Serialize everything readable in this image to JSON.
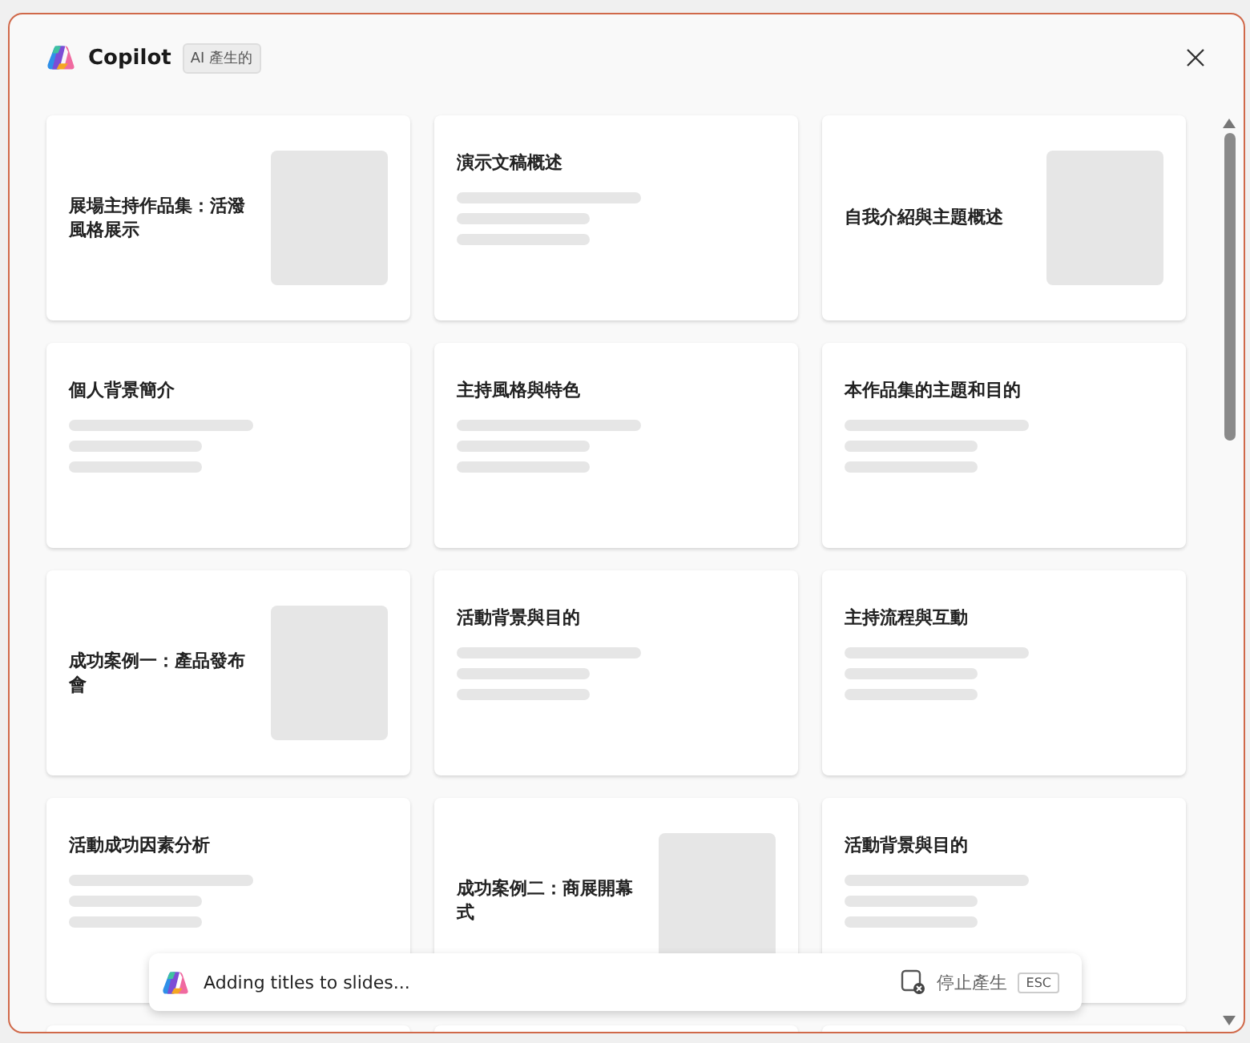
{
  "header": {
    "title": "Copilot",
    "badge": "AI 產生的"
  },
  "cards": [
    {
      "kind": "image",
      "title": "展場主持作品集：活潑風格展示"
    },
    {
      "kind": "text",
      "title": "演示文稿概述"
    },
    {
      "kind": "image",
      "title": "自我介紹與主題概述"
    },
    {
      "kind": "text",
      "title": "個人背景簡介"
    },
    {
      "kind": "text",
      "title": "主持風格與特色"
    },
    {
      "kind": "text",
      "title": "本作品集的主題和目的"
    },
    {
      "kind": "image",
      "title": "成功案例一：產品發布會"
    },
    {
      "kind": "text",
      "title": "活動背景與目的"
    },
    {
      "kind": "text",
      "title": "主持流程與互動"
    },
    {
      "kind": "text",
      "title": "活動成功因素分析"
    },
    {
      "kind": "image",
      "title": "成功案例二：商展開幕式"
    },
    {
      "kind": "text",
      "title": "活動背景與目的"
    },
    {
      "kind": "blank"
    },
    {
      "kind": "blank"
    },
    {
      "kind": "blank"
    }
  ],
  "status": {
    "message": "Adding titles to slides...",
    "stop_label": "停止產生",
    "shortcut": "ESC"
  }
}
